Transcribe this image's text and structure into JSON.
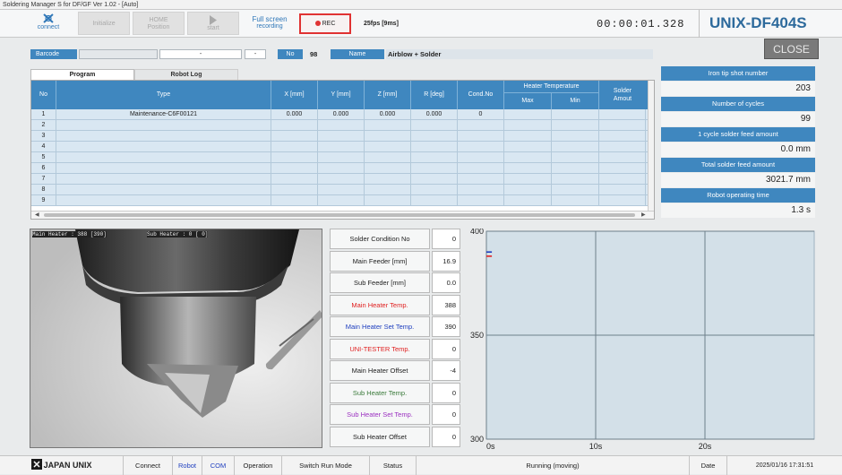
{
  "app": {
    "title": "Soldering Manager S for DF/GF Ver 1.02 - [Auto]"
  },
  "toolbar": {
    "connect": "connect",
    "initialize": "Initialize",
    "home_line1": "HOME",
    "home_line2": "Position",
    "start": "start",
    "fullscreen_line1": "Full screen",
    "fullscreen_line2": "recording",
    "rec": "REC",
    "fps": "25fps [9ms]",
    "timer": "00:00:01.328",
    "model": "UNIX-DF404S"
  },
  "close_label": "CLOSE",
  "barcode": {
    "label": "Barcode",
    "value1": "-",
    "value2": "-"
  },
  "program_no": {
    "label": "No",
    "value": "98"
  },
  "program_name": {
    "label": "Name",
    "value": "Airblow + Solder"
  },
  "tabs": [
    {
      "label": "Program"
    },
    {
      "label": "Robot Log"
    }
  ],
  "table": {
    "headers": {
      "no": "No",
      "type": "Type",
      "x": "X [mm]",
      "y": "Y [mm]",
      "z": "Z [mm]",
      "r": "R [deg]",
      "cond": "Cond.No",
      "heater": "Heater Temperature",
      "max": "Max",
      "min": "Min",
      "solder1": "Solder",
      "solder2": "Amout"
    },
    "rows": [
      {
        "no": "1",
        "type": "Maintenance-C6F00121",
        "x": "0.000",
        "y": "0.000",
        "z": "0.000",
        "r": "0.000",
        "cond": "0"
      },
      {
        "no": "2",
        "type": "",
        "x": "",
        "y": "",
        "z": "",
        "r": "",
        "cond": ""
      },
      {
        "no": "3",
        "type": "",
        "x": "",
        "y": "",
        "z": "",
        "r": "",
        "cond": ""
      },
      {
        "no": "4",
        "type": "",
        "x": "",
        "y": "",
        "z": "",
        "r": "",
        "cond": ""
      },
      {
        "no": "5",
        "type": "",
        "x": "",
        "y": "",
        "z": "",
        "r": "",
        "cond": ""
      },
      {
        "no": "6",
        "type": "",
        "x": "",
        "y": "",
        "z": "",
        "r": "",
        "cond": ""
      },
      {
        "no": "7",
        "type": "",
        "x": "",
        "y": "",
        "z": "",
        "r": "",
        "cond": ""
      },
      {
        "no": "8",
        "type": "",
        "x": "",
        "y": "",
        "z": "",
        "r": "",
        "cond": ""
      },
      {
        "no": "9",
        "type": "",
        "x": "",
        "y": "",
        "z": "",
        "r": "",
        "cond": ""
      }
    ]
  },
  "stats": [
    {
      "label": "Iron tip shot number",
      "value": "203"
    },
    {
      "label": "Number of cycles",
      "value": "99"
    },
    {
      "label": "1 cycle solder feed amount",
      "value": "0.0 mm"
    },
    {
      "label": "Total solder feed amount",
      "value": "3021.7 mm"
    },
    {
      "label": "Robot operating time",
      "value": "1.3 s"
    }
  ],
  "camera": {
    "main_heater": "Main Heater : 388 [390]",
    "sub_heater": "Sub Heater : 0 [ 0]"
  },
  "params": [
    {
      "label": "Solder Condition No",
      "value": "0",
      "color": "#222222"
    },
    {
      "label": "Main Feeder [mm]",
      "value": "16.9",
      "color": "#222222"
    },
    {
      "label": "Sub Feeder [mm]",
      "value": "0.0",
      "color": "#222222"
    },
    {
      "label": "Main Heater Temp.",
      "value": "388",
      "color": "#e02020"
    },
    {
      "label": "Main Heater Set Temp.",
      "value": "390",
      "color": "#1f3fbf"
    },
    {
      "label": "UNI-TESTER Temp.",
      "value": "0",
      "color": "#e02020"
    },
    {
      "label": "Main Heater Offset",
      "value": "-4",
      "color": "#222222"
    },
    {
      "label": "Sub Heater Temp.",
      "value": "0",
      "color": "#3a7a3a"
    },
    {
      "label": "Sub Heater Set Temp.",
      "value": "0",
      "color": "#9b2fc0"
    },
    {
      "label": "Sub Heater Offset",
      "value": "0",
      "color": "#222222"
    }
  ],
  "chart_data": {
    "type": "line",
    "x_ticks": [
      "0s",
      "10s",
      "20s"
    ],
    "y_ticks": [
      "400",
      "350",
      "300"
    ],
    "ylim": [
      300,
      400
    ],
    "xlim": [
      0,
      30
    ],
    "grid": true,
    "series": [
      {
        "color": "#e02020",
        "x": [
          0,
          0.5
        ],
        "y": [
          388,
          388
        ]
      },
      {
        "color": "#1f3fbf",
        "x": [
          0,
          0.5
        ],
        "y": [
          390,
          390
        ]
      }
    ]
  },
  "statusbar": {
    "logo": "JAPAN UNIX",
    "connect": "Connect",
    "robot": "Robot",
    "com": "COM",
    "operation": "Operation",
    "switch_run_mode": "Switch Run Mode",
    "status_label": "Status",
    "status_value": "Running (moving)",
    "date_label": "Date",
    "date_value": "2025/01/16 17:31:51"
  }
}
